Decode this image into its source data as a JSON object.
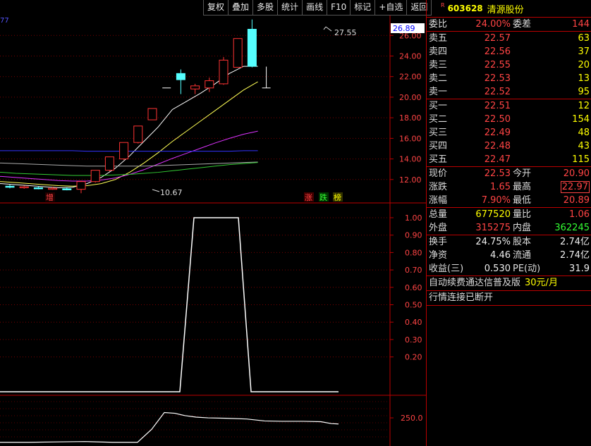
{
  "toolbar": [
    "复权",
    "叠加",
    "多股",
    "统计",
    "画线",
    "F10",
    "标记",
    "+自选",
    "返回"
  ],
  "stock": {
    "marker": "R",
    "code": "603628",
    "name": "清源股份"
  },
  "weibi": {
    "label1": "委比",
    "value1": "24.00%",
    "label2": "委差",
    "value2": "144"
  },
  "sell": [
    {
      "label": "卖五",
      "price": "22.57",
      "volume": "63"
    },
    {
      "label": "卖四",
      "price": "22.56",
      "volume": "37"
    },
    {
      "label": "卖三",
      "price": "22.55",
      "volume": "20"
    },
    {
      "label": "卖二",
      "price": "22.53",
      "volume": "13"
    },
    {
      "label": "卖一",
      "price": "22.52",
      "volume": "95"
    }
  ],
  "buy": [
    {
      "label": "买一",
      "price": "22.51",
      "volume": "12"
    },
    {
      "label": "买二",
      "price": "22.50",
      "volume": "154"
    },
    {
      "label": "买三",
      "price": "22.49",
      "volume": "48"
    },
    {
      "label": "买四",
      "price": "22.48",
      "volume": "43"
    },
    {
      "label": "买五",
      "price": "22.47",
      "volume": "115"
    }
  ],
  "quote": [
    {
      "l1": "现价",
      "v1": "22.53",
      "c1": "red",
      "l2": "今开",
      "v2": "20.90",
      "c2": "red",
      "boxed": false
    },
    {
      "l1": "涨跌",
      "v1": "1.65",
      "c1": "red",
      "l2": "最高",
      "v2": "22.97",
      "c2": "red",
      "boxed": true
    },
    {
      "l1": "涨幅",
      "v1": "7.90%",
      "c1": "red",
      "l2": "最低",
      "v2": "20.89",
      "c2": "red",
      "boxed": false
    }
  ],
  "volume": [
    {
      "l1": "总量",
      "v1": "677520",
      "c1": "yel",
      "l2": "量比",
      "v2": "1.06",
      "c2": "red"
    },
    {
      "l1": "外盘",
      "v1": "315275",
      "c1": "red",
      "l2": "内盘",
      "v2": "362245",
      "c2": "grn"
    }
  ],
  "finance": [
    {
      "l1": "换手",
      "v1": "24.75%",
      "l2": "股本",
      "v2": "2.74亿"
    },
    {
      "l1": "净资",
      "v1": "4.46",
      "l2": "流通",
      "v2": "2.74亿"
    },
    {
      "l1": "收益(三)",
      "v1": "0.530",
      "l2": "PE(动)",
      "v2": "31.9"
    }
  ],
  "ad": {
    "text": "自动续费通达信普及版",
    "price": "30元/月"
  },
  "connection": "行情连接已断开",
  "chart_labels": {
    "corner": "77",
    "current_price_box": "26.89",
    "high_label": "27.55",
    "low_label": "10.67",
    "tag_left": "增",
    "tag_zhang": "涨",
    "tag_die": "跌",
    "tag_bang": "榜",
    "bottom_axis": "250.0"
  },
  "chart_data": [
    {
      "type": "candlestick",
      "y_ticks": [
        26.0,
        24.0,
        22.0,
        20.0,
        18.0,
        16.0,
        14.0,
        12.0
      ],
      "ylim": [
        10.0,
        27.8
      ],
      "candles": [
        {
          "o": 11.35,
          "h": 11.5,
          "l": 11.15,
          "c": 11.25,
          "color": "cyan"
        },
        {
          "o": 11.3,
          "h": 11.4,
          "l": 11.1,
          "c": 11.2,
          "color": "red"
        },
        {
          "o": 11.2,
          "h": 11.35,
          "l": 11.05,
          "c": 11.15,
          "color": "cyan"
        },
        {
          "o": 11.15,
          "h": 11.3,
          "l": 11.0,
          "c": 11.1,
          "color": "red"
        },
        {
          "o": 11.1,
          "h": 11.25,
          "l": 10.95,
          "c": 11.05,
          "color": "cyan"
        },
        {
          "o": 11.05,
          "h": 11.9,
          "l": 10.67,
          "c": 11.8,
          "color": "red"
        },
        {
          "o": 11.8,
          "h": 12.9,
          "l": 11.7,
          "c": 12.9,
          "color": "red"
        },
        {
          "o": 12.9,
          "h": 14.2,
          "l": 12.8,
          "c": 14.2,
          "color": "red"
        },
        {
          "o": 14.0,
          "h": 15.6,
          "l": 13.9,
          "c": 15.6,
          "color": "red"
        },
        {
          "o": 15.6,
          "h": 17.2,
          "l": 15.5,
          "c": 17.2,
          "color": "red"
        },
        {
          "o": 17.8,
          "h": 18.9,
          "l": 17.8,
          "c": 18.9,
          "color": "red"
        },
        {
          "o": 20.9,
          "h": 20.9,
          "l": 20.9,
          "c": 20.9,
          "color": "white"
        },
        {
          "o": 21.7,
          "h": 22.7,
          "l": 20.3,
          "c": 22.3,
          "color": "cyan"
        },
        {
          "o": 20.8,
          "h": 21.3,
          "l": 20.3,
          "c": 21.1,
          "color": "red"
        },
        {
          "o": 20.9,
          "h": 21.9,
          "l": 20.5,
          "c": 21.6,
          "color": "red"
        },
        {
          "o": 21.3,
          "h": 23.9,
          "l": 21.2,
          "c": 23.6,
          "color": "red"
        },
        {
          "o": 22.9,
          "h": 25.7,
          "l": 22.9,
          "c": 25.7,
          "color": "red"
        },
        {
          "o": 26.6,
          "h": 27.55,
          "l": 22.9,
          "c": 23.0,
          "color": "cyan"
        },
        {
          "o": 20.9,
          "h": 22.97,
          "l": 20.89,
          "c": 20.9,
          "color": "white"
        }
      ],
      "ma": [
        {
          "color": "white",
          "values": [
            11.6,
            11.5,
            11.4,
            11.3,
            11.2,
            11.25,
            11.6,
            12.2,
            13.1,
            14.3,
            15.7,
            17.1,
            18.8,
            19.6,
            20.4,
            21.3,
            22.3,
            23.0,
            23.0
          ]
        },
        {
          "color": "yellow",
          "values": [
            11.8,
            11.7,
            11.6,
            11.5,
            11.4,
            11.35,
            11.4,
            11.6,
            12.0,
            12.7,
            13.6,
            14.6,
            15.7,
            16.7,
            17.7,
            18.7,
            19.7,
            20.7,
            21.5
          ]
        },
        {
          "color": "magenta",
          "values": [
            12.3,
            12.2,
            12.1,
            12.0,
            11.9,
            11.85,
            11.85,
            11.95,
            12.15,
            12.5,
            12.95,
            13.5,
            14.05,
            14.55,
            15.05,
            15.55,
            16.0,
            16.4,
            16.7
          ]
        },
        {
          "color": "blue",
          "values": [
            14.8,
            14.8,
            14.8,
            14.8,
            14.8,
            14.8,
            14.75,
            14.75,
            14.75,
            14.75,
            14.75,
            14.75,
            14.75,
            14.75,
            14.75,
            14.75,
            14.75,
            14.8,
            14.8
          ]
        },
        {
          "color": "#aaaaaa",
          "values": [
            13.6,
            13.55,
            13.5,
            13.45,
            13.4,
            13.35,
            13.3,
            13.3,
            13.3,
            13.3,
            13.3,
            13.35,
            13.4,
            13.45,
            13.5,
            13.55,
            13.6,
            13.65,
            13.7
          ]
        },
        {
          "color": "#33cc33",
          "values": [
            12.7,
            12.6,
            12.55,
            12.5,
            12.45,
            12.4,
            12.4,
            12.4,
            12.45,
            12.5,
            12.6,
            12.7,
            12.85,
            13.0,
            13.15,
            13.3,
            13.45,
            13.55,
            13.65
          ]
        }
      ]
    },
    {
      "type": "line",
      "y_ticks": [
        1.0,
        0.9,
        0.8,
        0.7,
        0.6,
        0.5,
        0.4,
        0.3,
        0.2
      ],
      "ylim": [
        0.0,
        1.0
      ],
      "points": [
        [
          0,
          0
        ],
        [
          255,
          0
        ],
        [
          275,
          1
        ],
        [
          338,
          1
        ],
        [
          356,
          0
        ],
        [
          480,
          0
        ]
      ]
    },
    {
      "type": "line",
      "y_ticks": [
        250.0
      ],
      "ylim": [
        180,
        300
      ],
      "points": [
        [
          0,
          186
        ],
        [
          40,
          186
        ],
        [
          80,
          187
        ],
        [
          120,
          188
        ],
        [
          160,
          186
        ],
        [
          195,
          186
        ],
        [
          215,
          220
        ],
        [
          233,
          264
        ],
        [
          248,
          262
        ],
        [
          262,
          256
        ],
        [
          278,
          252
        ],
        [
          295,
          250
        ],
        [
          320,
          249
        ],
        [
          350,
          247
        ],
        [
          375,
          242
        ],
        [
          400,
          241
        ],
        [
          430,
          241
        ],
        [
          455,
          240
        ],
        [
          470,
          235
        ],
        [
          480,
          234
        ]
      ]
    }
  ]
}
